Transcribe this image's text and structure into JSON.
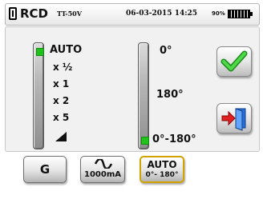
{
  "header": {
    "title": "RCD",
    "model": "TT-50V",
    "datetime": "06-03-2015 14:25",
    "battery": "90%"
  },
  "multiplier": {
    "selected": "AUTO",
    "items": [
      "x ½",
      "x 1",
      "x 2",
      "x 5"
    ],
    "ramp_icon": "ramp-icon"
  },
  "phase": {
    "items": [
      "0°",
      "180°"
    ],
    "selected": "0°-180°"
  },
  "side_buttons": {
    "confirm_icon": "checkmark-icon",
    "exit_icon": "exit-door-icon"
  },
  "bottom": {
    "type_label": "G",
    "current_label": "1000mA",
    "current_icon": "ac-sine-icon",
    "phase_top": "AUTO",
    "phase_bottom": "0°- 180°"
  },
  "colors": {
    "led": "#21c11e",
    "check": "#2fbf2a",
    "exit_arrow": "#e02020",
    "active_border": "#d2a300"
  }
}
